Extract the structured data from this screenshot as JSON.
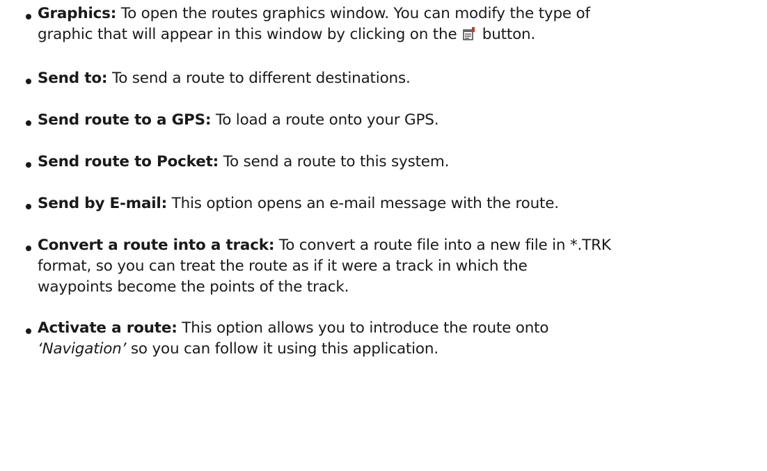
{
  "items": [
    {
      "term": "Graphics:",
      "line1": "To open the routes graphics window. You can modify the type of",
      "line2_before": "graphic that will appear in this window by clicking on the",
      "icon": "properties-icon",
      "line2_after": "button."
    },
    {
      "term": "Send to:",
      "text": "To send a route to different destinations."
    },
    {
      "term": "Send route to a GPS:",
      "text": "To load a route onto your GPS."
    },
    {
      "term": "Send route to Pocket:",
      "text": "To send a route to this system."
    },
    {
      "term": "Send by E-mail:",
      "text": "This option opens an e-mail message with the route."
    },
    {
      "term": "Convert a route into a track:",
      "line1": "To convert a route file into a new file in *.TRK",
      "line2": "format, so you can treat the route as if it were a track in which the",
      "line3": "waypoints become the points of the track."
    },
    {
      "term": "Activate a route:",
      "line1": "This option allows you to introduce the route onto",
      "line2_em": "‘Navigation’",
      "line2_after": "so you can follow it using this application."
    }
  ]
}
